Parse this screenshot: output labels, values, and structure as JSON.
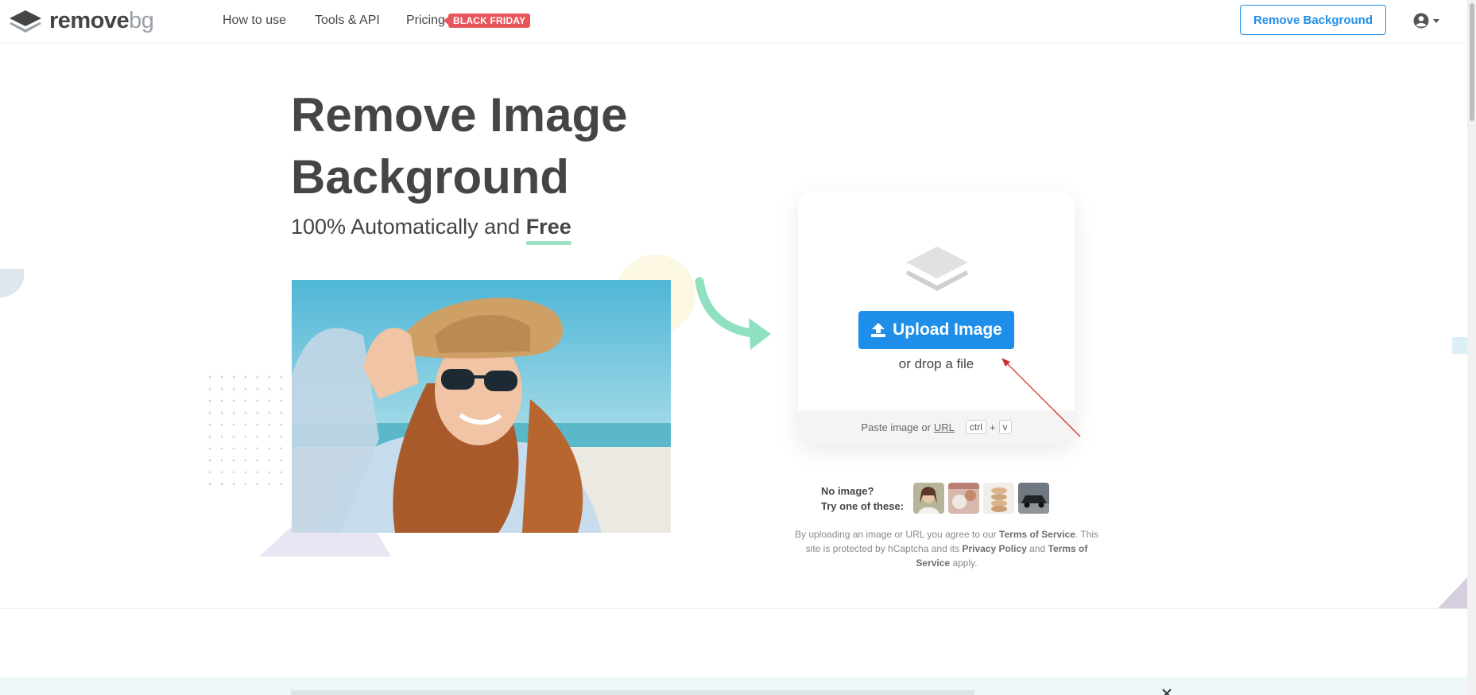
{
  "brand": {
    "word1": "remove",
    "word2": "bg"
  },
  "nav": {
    "how_to_use": "How to use",
    "tools_api": "Tools & API",
    "pricing": "Pricing",
    "pricing_badge": "BLACK FRIDAY"
  },
  "header": {
    "cta": "Remove Background"
  },
  "hero": {
    "title_line1": "Remove Image",
    "title_line2": "Background",
    "subtitle_prefix": "100% Automatically and ",
    "subtitle_emphasis": "Free"
  },
  "upload": {
    "button_label": "Upload Image",
    "drop_text": "or drop a file",
    "paste_prefix": "Paste image or ",
    "paste_url": "URL",
    "key_ctrl": "ctrl",
    "key_plus": "+",
    "key_v": "v"
  },
  "samples": {
    "line1": "No image?",
    "line2": "Try one of these:"
  },
  "legal": {
    "t1": "By uploading an image or URL you agree to our ",
    "tos": "Terms of Service",
    "t2": ". This site is protected by hCaptcha and its ",
    "privacy": "Privacy Policy",
    "t3": " and ",
    "tos2": "Terms of Service",
    "t4": " apply."
  },
  "colors": {
    "accent": "#1f8ee9",
    "badge": "#e8565c",
    "highlight": "#9be3c1",
    "text": "#454545"
  }
}
